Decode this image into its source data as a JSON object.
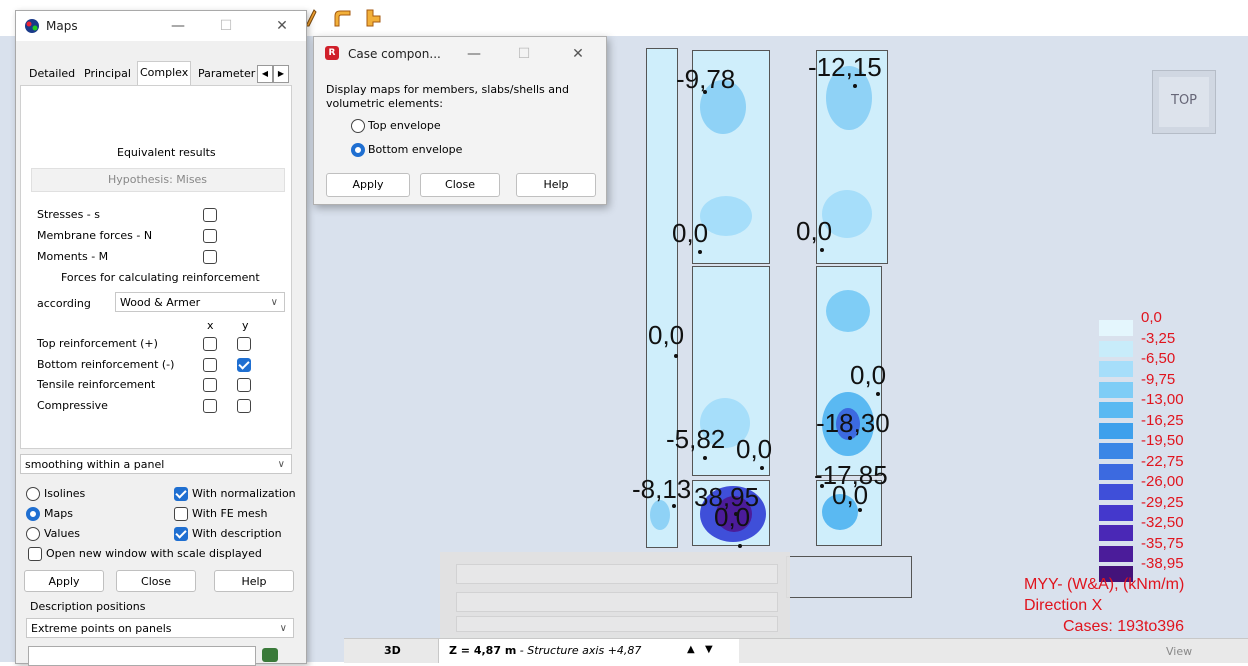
{
  "maps_window": {
    "title": "Maps",
    "tabs": [
      "Detailed",
      "Principal",
      "Complex",
      "Parameter"
    ],
    "active_tab": "Complex",
    "equivalent_results": "Equivalent results",
    "hypothesis": "Hypothesis: Mises",
    "checks": [
      {
        "label": "Stresses - s",
        "checked": false
      },
      {
        "label": "Membrane forces - N",
        "checked": false
      },
      {
        "label": "Moments - M",
        "checked": false
      }
    ],
    "reinforcement_heading": "Forces for calculating reinforcement",
    "according_label": "according",
    "according_value": "Wood & Armer",
    "col_x": "x",
    "col_y": "y",
    "reinf_rows": [
      {
        "label": "Top reinforcement (+)",
        "x": false,
        "y": false
      },
      {
        "label": "Bottom reinforcement (-)",
        "x": false,
        "y": true
      },
      {
        "label": "Tensile reinforcement",
        "x": false,
        "y": false
      },
      {
        "label": "Compressive",
        "x": false,
        "y": false
      }
    ],
    "smoothing": "smoothing within a panel",
    "display_options": [
      {
        "label": "Isolines",
        "selected": false
      },
      {
        "label": "Maps",
        "selected": true
      },
      {
        "label": "Values",
        "selected": false
      }
    ],
    "flags": [
      {
        "label": "With normalization",
        "checked": true
      },
      {
        "label": "With FE mesh",
        "checked": false
      },
      {
        "label": "With description",
        "checked": true
      }
    ],
    "open_new_window": "Open new window with scale displayed",
    "apply": "Apply",
    "close": "Close",
    "help": "Help",
    "desc_positions_label": "Description positions",
    "desc_positions_value": "Extreme points on panels"
  },
  "case_window": {
    "title": "Case compon...",
    "description": "Display maps for members, slabs/shells and volumetric elements:",
    "options": [
      {
        "label": "Top envelope",
        "selected": false
      },
      {
        "label": "Bottom envelope",
        "selected": true
      }
    ],
    "apply": "Apply",
    "close": "Close",
    "help": "Help"
  },
  "map_labels": {
    "a": "-9,78",
    "b": "-12,15",
    "c": "0,0",
    "d": "0,0",
    "e": "0,0",
    "f": "0,0",
    "g": "-18,30",
    "h": "-5,82",
    "i": "0,0",
    "j": "-17,85",
    "k": "-8,13",
    "l": "38,95",
    "m": "0,0",
    "n": "0,0"
  },
  "view_cube_label": "TOP",
  "legend": {
    "values": [
      "0,0",
      "-3,25",
      "-6,50",
      "-9,75",
      "-13,00",
      "-16,25",
      "-19,50",
      "-22,75",
      "-26,00",
      "-29,25",
      "-32,50",
      "-35,75",
      "-38,95"
    ],
    "colors": [
      "#e4f6fd",
      "#c8ecfa",
      "#a6defa",
      "#7fcdf6",
      "#5ab9f2",
      "#3ea0ec",
      "#3a86e6",
      "#3c6ae0",
      "#3f4fd9",
      "#4438cc",
      "#4a28b6",
      "#4b1c9a",
      "#44137a"
    ],
    "caption": "MYY- (W&A), (kNm/m)",
    "direction": "Direction X",
    "cases": "Cases: 193to396"
  },
  "bottom_bar": {
    "mode": "3D",
    "z_label": "Z = 4,87 m",
    "z_desc": " - Structure axis +4,87",
    "view": "View"
  },
  "ghost_rows": [
    "Structure axis +4,87",
    "Z = 4,87 m"
  ]
}
